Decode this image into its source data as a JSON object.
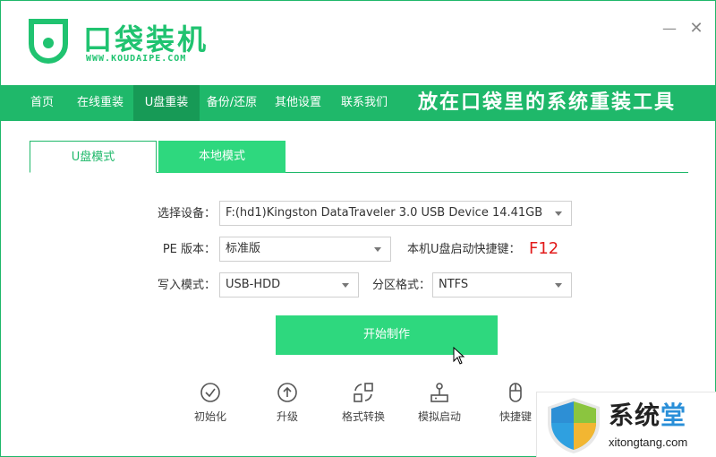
{
  "app": {
    "logo_title": "口袋装机",
    "logo_url": "WWW.KOUDAIPE.COM",
    "minimize_glyph": "—",
    "close_glyph": "✕",
    "brand_color": "#1fb86a"
  },
  "nav": {
    "items": [
      {
        "label": "首页"
      },
      {
        "label": "在线重装"
      },
      {
        "label": "U盘重装"
      },
      {
        "label": "备份/还原"
      },
      {
        "label": "其他设置"
      },
      {
        "label": "联系我们"
      }
    ],
    "active_index": 2,
    "slogan": "放在口袋里的系统重装工具"
  },
  "tabs": [
    {
      "label": "U盘模式",
      "active": true
    },
    {
      "label": "本地模式",
      "active": false
    }
  ],
  "form": {
    "device_label": "选择设备：",
    "device_value": "F:(hd1)Kingston DataTraveler 3.0 USB Device 14.41GB",
    "pe_label": "PE 版本：",
    "pe_value": "标准版",
    "hotkey_label": "本机U盘启动快捷键：",
    "hotkey_value": "F12",
    "write_label": "写入模式：",
    "write_value": "USB-HDD",
    "partition_label": "分区格式：",
    "partition_value": "NTFS"
  },
  "start_button": "开始制作",
  "tools": [
    {
      "label": "初始化",
      "icon": "check-circle-icon"
    },
    {
      "label": "升级",
      "icon": "arrow-up-circle-icon"
    },
    {
      "label": "格式转换",
      "icon": "convert-icon"
    },
    {
      "label": "模拟启动",
      "icon": "joystick-icon"
    },
    {
      "label": "快捷键",
      "icon": "mouse-icon"
    }
  ],
  "watermark": {
    "title_a": "系统",
    "title_b": "堂",
    "url": "xitongtang.com"
  }
}
